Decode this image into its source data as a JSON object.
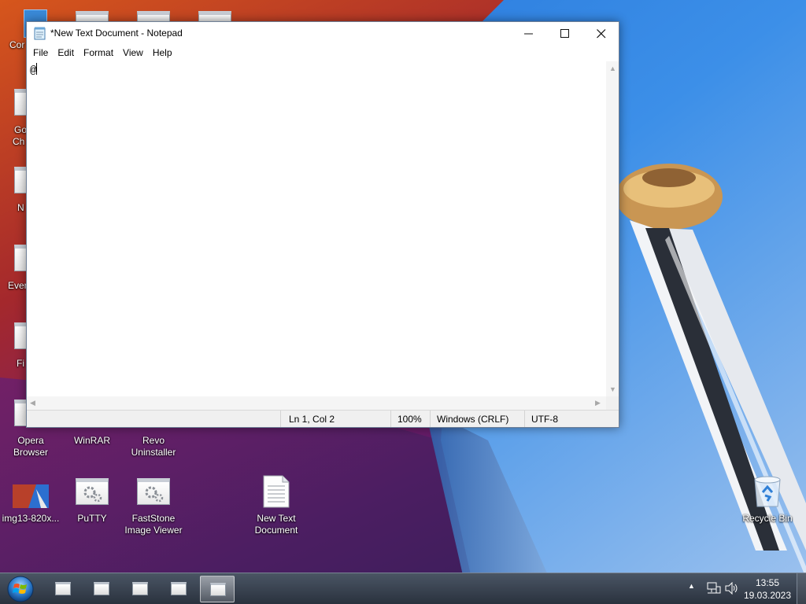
{
  "notepad": {
    "title": "*New Text Document - Notepad",
    "menu": [
      "File",
      "Edit",
      "Format",
      "View",
      "Help"
    ],
    "content": "@",
    "status": {
      "position": "Ln 1, Col 2",
      "zoom": "100%",
      "line_endings": "Windows (CRLF)",
      "encoding": "UTF-8"
    },
    "controls": {
      "minimize": "—",
      "maximize": "☐",
      "close": "✕"
    }
  },
  "desktop": {
    "partial_labels": [
      "Cor",
      "Go",
      "Ch",
      "N",
      "Ever",
      "Fi"
    ],
    "icons": [
      {
        "label": "Opera\nBrowser",
        "icon": "gear-icon"
      },
      {
        "label": "WinRAR",
        "icon": "gear-icon"
      },
      {
        "label": "Revo\nUninstaller",
        "icon": "gear-icon"
      },
      {
        "label": "img13-820x...",
        "icon": "image-thumbnail-icon"
      },
      {
        "label": "PuTTY",
        "icon": "gear-icon"
      },
      {
        "label": "FastStone\nImage Viewer",
        "icon": "gear-icon"
      },
      {
        "label": "New Text\nDocument",
        "icon": "text-document-icon"
      },
      {
        "label": "Recycle Bin",
        "icon": "recycle-bin-icon"
      }
    ]
  },
  "taskbar": {
    "clock_time": "13:55",
    "clock_date": "19.03.2023",
    "buttons": 5,
    "tray_icons": [
      "show-hidden-icons-icon",
      "network-icon",
      "volume-icon"
    ]
  }
}
